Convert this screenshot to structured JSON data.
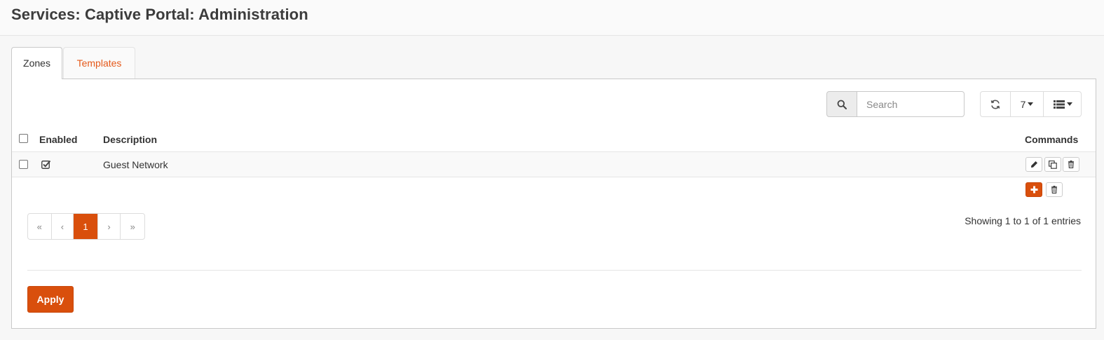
{
  "page": {
    "title": "Services: Captive Portal: Administration"
  },
  "tabs": [
    {
      "label": "Zones",
      "active": true
    },
    {
      "label": "Templates",
      "active": false
    }
  ],
  "toolbar": {
    "search_placeholder": "Search",
    "rows_per_page": "7",
    "icons": [
      "search-icon",
      "refresh-icon",
      "columns-icon"
    ]
  },
  "table": {
    "headers": {
      "enabled": "Enabled",
      "description": "Description",
      "commands": "Commands"
    },
    "rows": [
      {
        "selected": false,
        "enabled": true,
        "description": "Guest Network"
      }
    ]
  },
  "pagination": {
    "first": "«",
    "prev": "‹",
    "current": "1",
    "next": "›",
    "last": "»"
  },
  "info": "Showing 1 to 1 of 1 entries",
  "actions": {
    "apply": "Apply"
  },
  "colors": {
    "accent": "#d94f0c",
    "tab_link": "#e5591a"
  }
}
